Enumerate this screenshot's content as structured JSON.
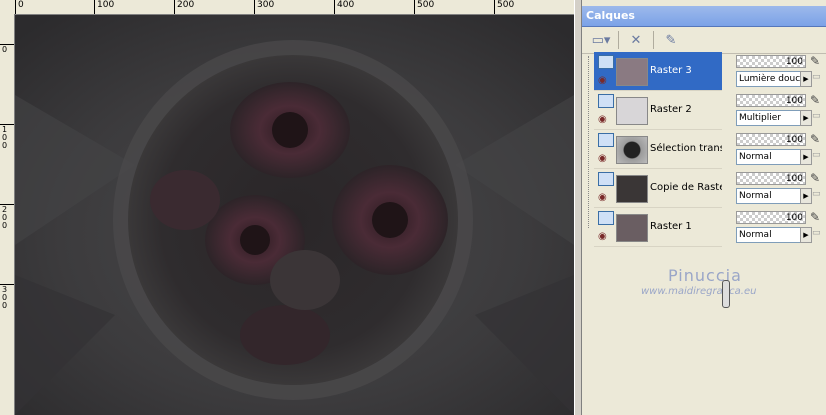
{
  "ruler": {
    "h_labels": [
      "0",
      "100",
      "200",
      "300",
      "400",
      "500"
    ],
    "v_labels": [
      "0",
      "100",
      "200",
      "300"
    ]
  },
  "panel": {
    "title": "Calques",
    "layers": [
      {
        "name": "Raster 3",
        "opacity": "100",
        "blend": "Lumière douce",
        "selected": true
      },
      {
        "name": "Raster 2",
        "opacity": "100",
        "blend": "Multiplier",
        "selected": false
      },
      {
        "name": "Sélection transfor",
        "opacity": "100",
        "blend": "Normal",
        "selected": false
      },
      {
        "name": "Copie de Raster",
        "opacity": "100",
        "blend": "Normal",
        "selected": false
      },
      {
        "name": "Raster 1",
        "opacity": "100",
        "blend": "Normal",
        "selected": false
      }
    ]
  },
  "watermark": {
    "name": "Pinuccia",
    "url": "www.maidiregrafica.eu"
  },
  "colors": {
    "selection": "#316ac5",
    "panel_title": "#7ba2e7",
    "canvas_bg": "#3b3b3d"
  }
}
